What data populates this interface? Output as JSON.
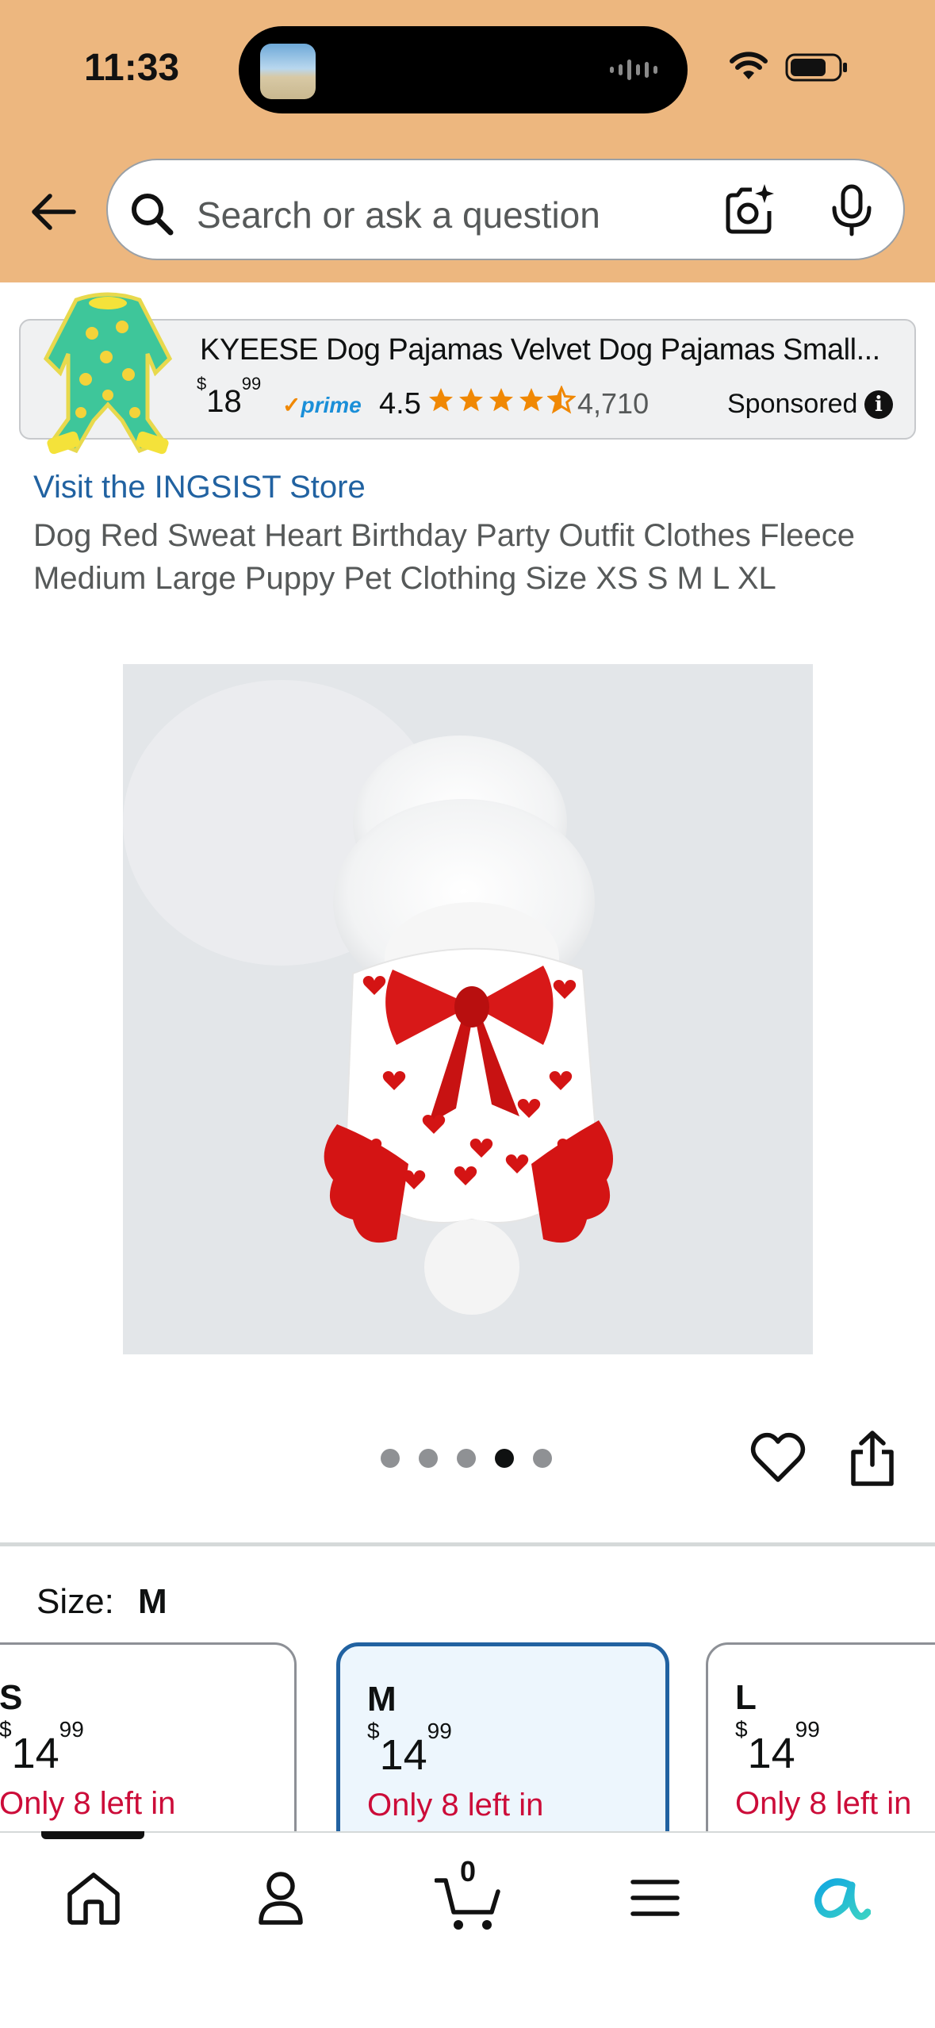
{
  "status_bar": {
    "time": "11:33"
  },
  "header": {
    "search_placeholder": "Search or ask a question",
    "back_icon": "arrow-left-icon",
    "camera_icon": "camera-sparkle-icon",
    "mic_icon": "microphone-icon",
    "background": "#edb77f"
  },
  "sponsored_ad": {
    "title": "KYEESE Dog Pajamas Velvet Dog Pajamas Small...",
    "price_whole": "18",
    "price_fraction": "99",
    "currency": "$",
    "prime": "prime",
    "rating": "4.5",
    "review_count": "4,710",
    "label": "Sponsored",
    "info_icon": "info-icon"
  },
  "product": {
    "store_link": "Visit the INGSIST Store",
    "title": "Dog Red Sweat Heart Birthday Party Outfit Clothes Fleece Medium Large Puppy Pet Clothing Size XS S M L XL",
    "image_count": 5,
    "active_image": 4
  },
  "size": {
    "label": "Size:",
    "selected": "M",
    "options": [
      {
        "name": "S",
        "currency": "$",
        "price_whole": "14",
        "price_fraction": "99",
        "stock": "Only 8 left in"
      },
      {
        "name": "M",
        "currency": "$",
        "price_whole": "14",
        "price_fraction": "99",
        "stock": "Only 8 left in"
      },
      {
        "name": "L",
        "currency": "$",
        "price_whole": "14",
        "price_fraction": "99",
        "stock": "Only 8 left in"
      }
    ]
  },
  "bottom_nav": {
    "items": [
      "home-icon",
      "profile-icon",
      "cart-icon",
      "menu-icon",
      "rufus-icon"
    ],
    "cart_count": "0"
  },
  "colors": {
    "link": "#2162a1",
    "stock": "#cc0c39",
    "selected_border": "#2162a1",
    "star": "#f08804"
  }
}
